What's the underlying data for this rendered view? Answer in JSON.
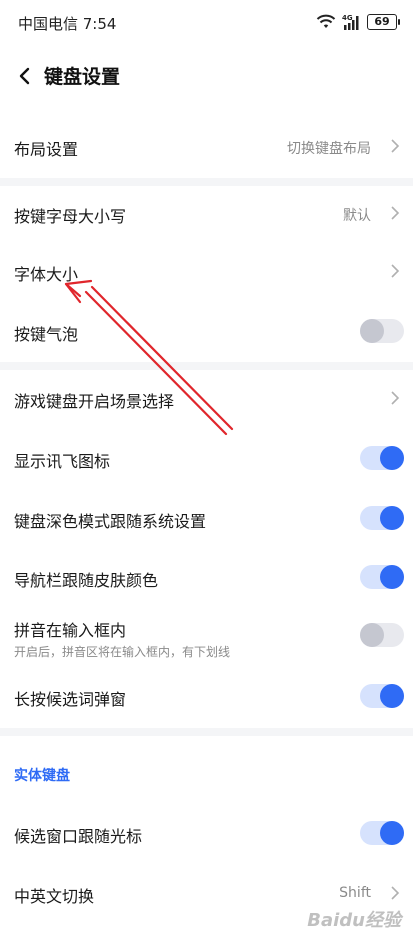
{
  "status": {
    "carrier_time": "中国电信 7:54",
    "network": "4G",
    "battery": "69"
  },
  "header": {
    "title": "键盘设置"
  },
  "rows": {
    "layout": {
      "label": "布局设置",
      "value": "切换键盘布局"
    },
    "case": {
      "label": "按键字母大小写",
      "value": "默认"
    },
    "font_size": {
      "label": "字体大小"
    },
    "bubble": {
      "label": "按键气泡",
      "toggle": "off"
    },
    "game_keyboard": {
      "label": "游戏键盘开启场景选择"
    },
    "show_icon": {
      "label": "显示讯飞图标",
      "toggle": "on"
    },
    "dark_mode": {
      "label": "键盘深色模式跟随系统设置",
      "toggle": "on"
    },
    "navbar": {
      "label": "导航栏跟随皮肤颜色",
      "toggle": "on"
    },
    "pinyin_inline": {
      "label": "拼音在输入框内",
      "sub": "开启后，拼音区将在输入框内，有下划线",
      "toggle": "off"
    },
    "long_press": {
      "label": "长按候选词弹窗",
      "toggle": "on"
    }
  },
  "physical_keyboard": {
    "section_title": "实体键盘",
    "follow_cursor": {
      "label": "候选窗口跟随光标",
      "toggle": "on"
    },
    "switch_lang": {
      "label": "中英文切换",
      "value": "Shift"
    }
  },
  "watermark": "Baidu经验",
  "colors": {
    "accent": "#2f6bf5",
    "annotation_arrow": "#e0262c"
  }
}
